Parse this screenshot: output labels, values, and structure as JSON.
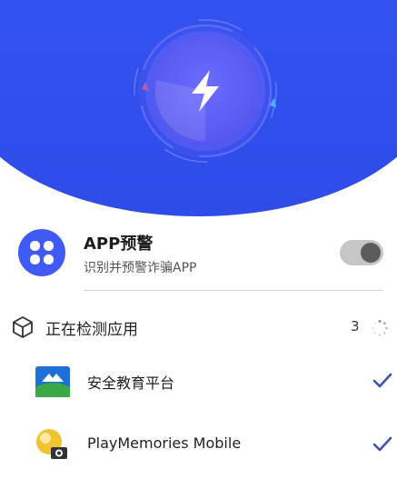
{
  "colors": {
    "hero_blue": "#3a5cff",
    "accent_purple": "#5a5cf3",
    "check_blue": "#3d4fb8"
  },
  "hero": {
    "icon": "lightning-bolt-icon"
  },
  "app_warning": {
    "title": "APP预警",
    "subtitle": "识别并预警诈骗APP",
    "toggle_state": "off",
    "icon": "four-petal-icon"
  },
  "scanning": {
    "title": "正在检测应用",
    "count": "3",
    "icon": "cube-icon",
    "spinner_icon": "loading-spinner-icon"
  },
  "apps": [
    {
      "name": "安全教育平台",
      "icon": "safety-education-app-icon",
      "checked": true
    },
    {
      "name": "PlayMemories Mobile",
      "icon": "playmemories-app-icon",
      "checked": true
    }
  ]
}
